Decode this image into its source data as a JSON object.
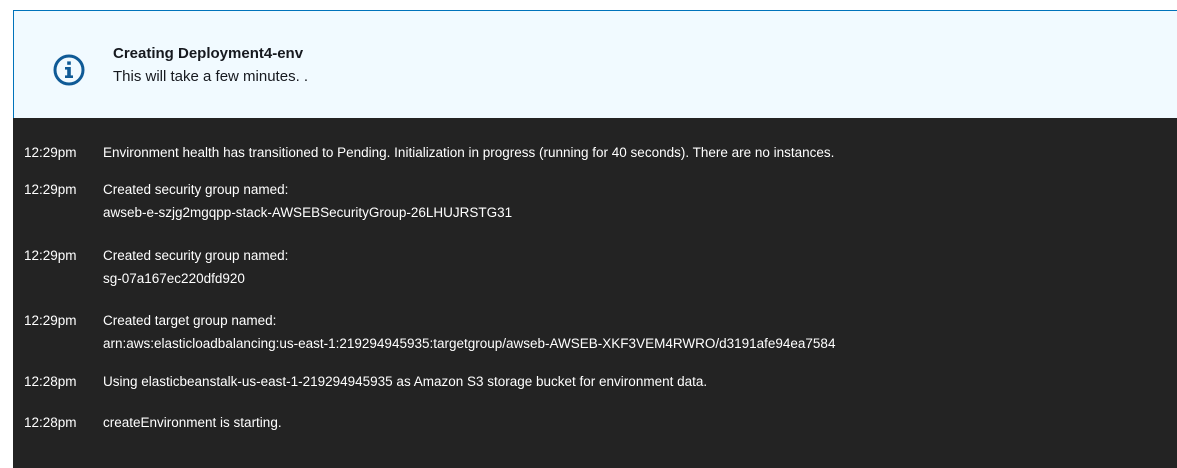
{
  "flash": {
    "type": "info",
    "icon": "info-icon",
    "title": "Creating Deployment4-env",
    "message": "This will take a few minutes. ."
  },
  "events": [
    {
      "time": "12:29pm",
      "message": "Environment health has transitioned to Pending. Initialization in progress (running for 40 seconds). There are no instances."
    },
    {
      "time": "12:29pm",
      "message": "Created security group named:",
      "detail": "awseb-e-szjg2mgqpp-stack-AWSEBSecurityGroup-26LHUJRSTG31"
    },
    {
      "time": "12:29pm",
      "message": "Created security group named:",
      "detail": "sg-07a167ec220dfd920"
    },
    {
      "time": "12:29pm",
      "message": "Created target group named:",
      "detail": "arn:aws:elasticloadbalancing:us-east-1:219294945935:targetgroup/awseb-AWSEB-XKF3VEM4RWRO/d3191afe94ea7584"
    },
    {
      "time": "12:28pm",
      "message": "Using elasticbeanstalk-us-east-1-219294945935 as Amazon S3 storage bucket for environment data."
    },
    {
      "time": "12:28pm",
      "message": "createEnvironment is starting."
    }
  ],
  "colors": {
    "flash_background": "#f1faff",
    "flash_border": "#0073bb",
    "info_icon": "#0f5a96",
    "log_background": "#232323",
    "log_text": "#ffffff"
  }
}
